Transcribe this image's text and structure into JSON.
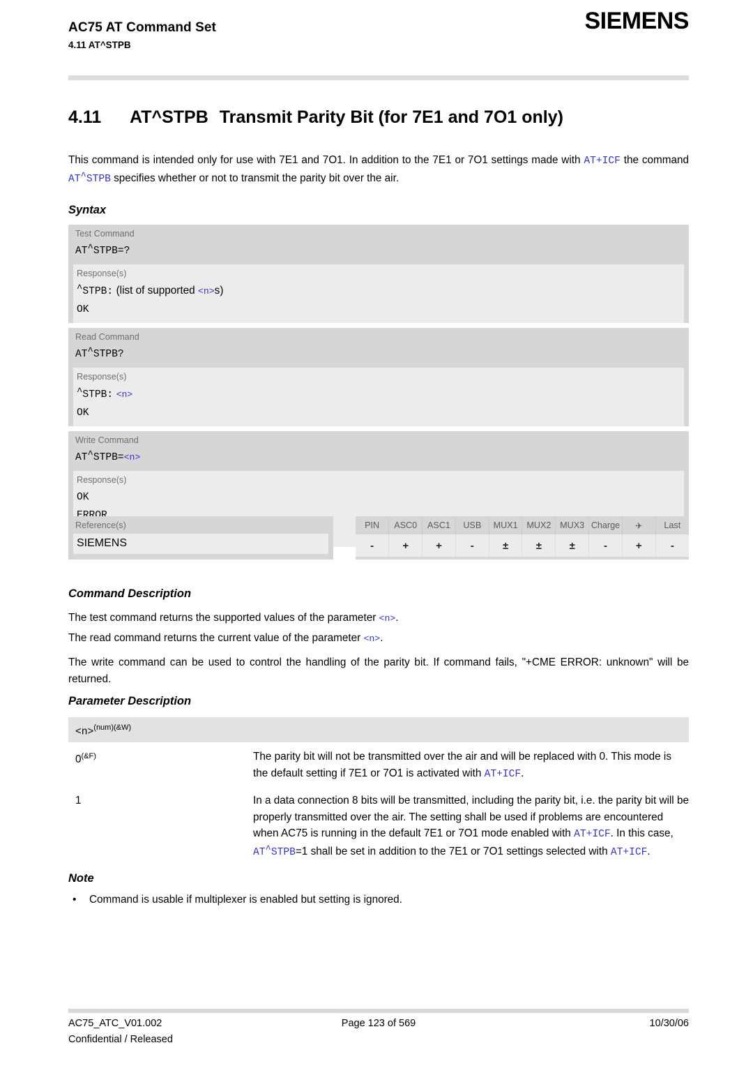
{
  "header": {
    "document_title": "AC75 AT Command Set",
    "section_ref": "4.11 AT^STPB",
    "brand": "SIEMENS"
  },
  "title": {
    "number": "4.11",
    "command": "AT^STPB",
    "text": "Transmit Parity Bit (for 7E1 and 7O1 only)"
  },
  "intro": {
    "part1": "This command is intended only for use with 7E1 and 7O1. In addition to the 7E1 or 7O1 settings made with ",
    "ref1": "AT+ICF",
    "part2": " the command ",
    "ref2_pre": "AT",
    "ref2_post": "STPB",
    "part3": " specifies whether or not to transmit the parity bit over the air."
  },
  "sections": {
    "syntax": "Syntax",
    "command_description": "Command Description",
    "parameter_description": "Parameter Description",
    "note": "Note"
  },
  "syntax": {
    "command_label": "Test Command",
    "response_label": "Response(s)",
    "test": {
      "label": "Test Command",
      "command_pre": "AT",
      "command_post": "STPB=?",
      "response_label": "Response(s)",
      "resp_pre": "STPB:",
      "resp_text1": "(list of supported ",
      "resp_param": "<n>",
      "resp_text2": "s)",
      "resp_ok": "OK"
    },
    "read": {
      "label": "Read Command",
      "command_pre": "AT",
      "command_post": "STPB?",
      "response_label": "Response(s)",
      "resp_pre": "STPB:",
      "resp_param": "<n>",
      "resp_ok": "OK"
    },
    "write": {
      "label": "Write Command",
      "command_pre": "AT",
      "command_post": "STPB=",
      "command_param": "<n>",
      "response_label": "Response(s)",
      "resp_ok": "OK",
      "resp_error": "ERROR",
      "resp_cme": "+CME ERROR: unknown"
    },
    "reference": {
      "label": "Reference(s)",
      "value": "SIEMENS"
    },
    "capabilities": {
      "columns": [
        "PIN",
        "ASC0",
        "ASC1",
        "USB",
        "MUX1",
        "MUX2",
        "MUX3",
        "Charge",
        "✈",
        "Last"
      ],
      "values": [
        "-",
        "+",
        "+",
        "-",
        "±",
        "±",
        "±",
        "-",
        "+",
        "-"
      ],
      "airplane_icon_name": "airplane-mode-icon"
    }
  },
  "command_description": {
    "line1_a": "The test command returns the supported values of the parameter ",
    "line1_param": "<n>",
    "line1_b": ".",
    "line2_a": "The read command returns the current value of the parameter ",
    "line2_param": "<n>",
    "line2_b": ".",
    "line3": "The write command can be used to control the handling of the parity bit. If command fails, \"+CME ERROR: unknown\" will be returned."
  },
  "parameter_description": {
    "header_param": "<n>",
    "header_sup": "(num)(&W)",
    "rows": [
      {
        "key": "0",
        "key_sup": "(&F)",
        "text_a": "The parity bit will not be transmitted over the air and will be replaced with 0. This mode is the default setting if 7E1 or 7O1 is activated with ",
        "ref": "AT+ICF",
        "text_b": "."
      },
      {
        "key": "1",
        "key_sup": "",
        "text_a": "In a data connection 8 bits will be transmitted, including the parity bit, i.e. the parity bit will be properly transmitted over the air. The setting shall be used if problems are encountered when AC75 is running in the default 7E1 or 7O1 mode enabled with ",
        "ref": "AT+ICF",
        "text_b": ". In this case, ",
        "ref2_pre": "AT",
        "ref2_post": "STPB",
        "text_c": "=1 shall be set in addition to the 7E1 or 7O1 settings selected with ",
        "ref3": "AT+ICF",
        "text_d": "."
      }
    ]
  },
  "note": {
    "bullet": "•",
    "text": "Command is usable if multiplexer is enabled but setting is ignored."
  },
  "footer": {
    "left_line1": "AC75_ATC_V01.002",
    "left_line2": "Confidential / Released",
    "center": "Page 123 of 569",
    "right": "10/30/06"
  },
  "colors": {
    "reference_blue": "#3333cc",
    "block_gray": "#d6d6d6",
    "response_gray": "#ececec",
    "rule_gray": "#dcdcdc"
  }
}
